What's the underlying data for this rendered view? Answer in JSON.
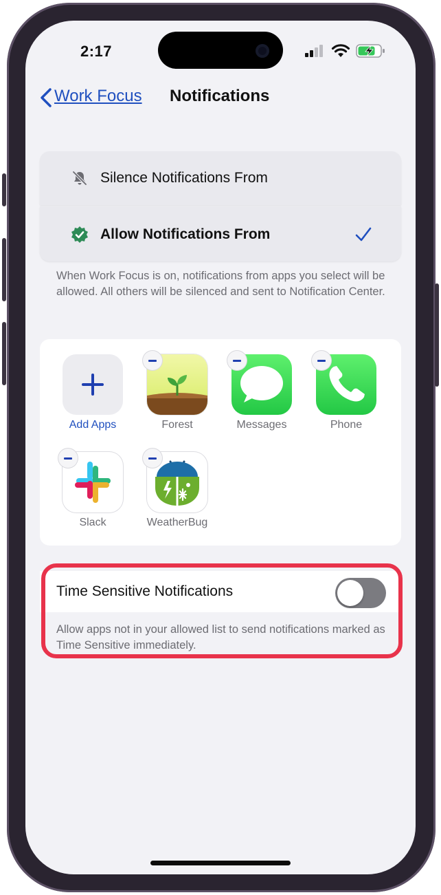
{
  "status_bar": {
    "time": "2:17"
  },
  "nav": {
    "back_label": "Work Focus",
    "title": "Notifications"
  },
  "mode_options": [
    {
      "label": "Silence Notifications From",
      "selected": false
    },
    {
      "label": "Allow Notifications From",
      "selected": true
    }
  ],
  "mode_description": "When Work Focus is on, notifications from apps you select will be allowed. All others will be silenced and sent to Notification Center.",
  "apps": {
    "add_label": "Add Apps",
    "items": [
      {
        "name": "Forest"
      },
      {
        "name": "Messages"
      },
      {
        "name": "Phone"
      },
      {
        "name": "Slack"
      },
      {
        "name": "WeatherBug"
      }
    ]
  },
  "time_sensitive": {
    "label": "Time Sensitive Notifications",
    "enabled": false,
    "description": "Allow apps not in your allowed list to send notifications marked as Time Sensitive immediately."
  },
  "colors": {
    "accent": "#1f4fbf",
    "highlight": "#e8334b",
    "toggle_off": "#7b7b80"
  }
}
